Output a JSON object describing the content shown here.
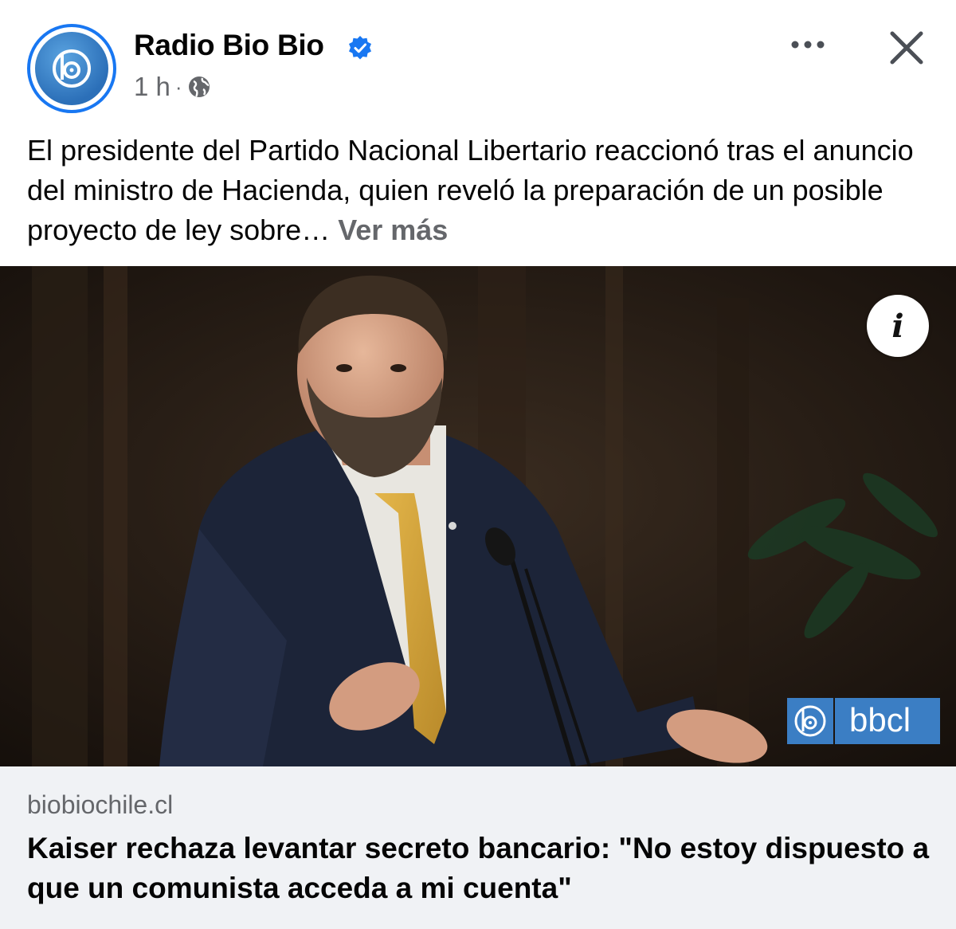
{
  "post": {
    "page_name": "Radio Bio Bio",
    "timestamp": "1 h",
    "separator": "·",
    "audience_icon": "globe-icon",
    "verified_icon": "verified-badge-icon",
    "text": "El presidente del Partido Nacional Libertario reaccionó tras el anuncio del ministro de Hacienda, quien reveló la preparación de un posible proyecto de ley sobre… ",
    "see_more": "Ver más"
  },
  "media": {
    "info_label": "i",
    "watermark": "bbcl"
  },
  "link": {
    "domain": "biobiochile.cl",
    "headline": "Kaiser rechaza levantar secreto bancario: \"No estoy dispuesto a que un comunista acceda a mi cuenta\""
  },
  "colors": {
    "brand_blue": "#1877f2",
    "bbcl_blue": "#3b7ec4",
    "secondary_text": "#65676b",
    "link_box_bg": "#f0f2f5"
  }
}
